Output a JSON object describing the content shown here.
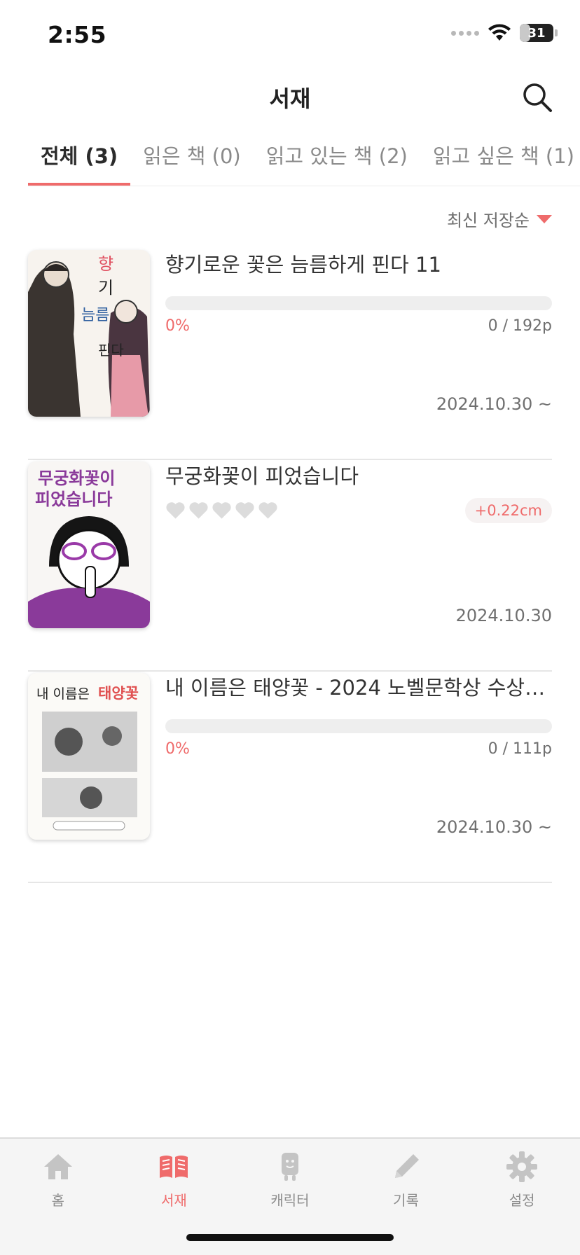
{
  "status_bar": {
    "time": "2:55",
    "battery": "31",
    "battery_level": 0.31
  },
  "header": {
    "title": "서재"
  },
  "tabs": [
    {
      "label": "전체 (3)",
      "active": true
    },
    {
      "label": "읽은 책 (0)",
      "active": false
    },
    {
      "label": "읽고 있는 책 (2)",
      "active": false
    },
    {
      "label": "읽고 싶은 책 (1)",
      "active": false
    }
  ],
  "sort": {
    "label": "최신 저장순"
  },
  "books": [
    {
      "title": "향기로운 꽃은 늠름하게 핀다 11",
      "progress": 0,
      "percent": "0%",
      "pages": "0 / 192p",
      "date": "2024.10.30 ~"
    },
    {
      "title": "무궁화꽃이 피었습니다",
      "rating": 0,
      "rating_max": 5,
      "growth": "+0.22cm",
      "date": "2024.10.30"
    },
    {
      "title": "내 이름은 태양꽃 - 2024 노벨문학상 수상…",
      "progress": 0,
      "percent": "0%",
      "pages": "0 / 111p",
      "date": "2024.10.30 ~"
    }
  ],
  "bottom_nav": [
    {
      "label": "홈",
      "icon": "home-icon",
      "active": false
    },
    {
      "label": "서재",
      "icon": "book-open-icon",
      "active": true
    },
    {
      "label": "캐릭터",
      "icon": "character-icon",
      "active": false
    },
    {
      "label": "기록",
      "icon": "pencil-icon",
      "active": false
    },
    {
      "label": "설정",
      "icon": "gear-icon",
      "active": false
    }
  ],
  "colors": {
    "accent": "#ef6b6b",
    "inactive": "#bdbdbd",
    "nav_bg": "#f5f5f5"
  }
}
